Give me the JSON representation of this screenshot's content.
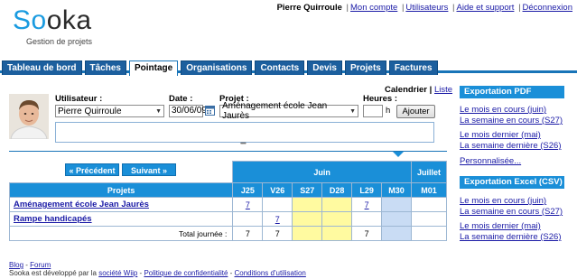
{
  "logo": {
    "blue": "So",
    "dark": "oka",
    "tagline": "Gestion de projets"
  },
  "topnav": {
    "user": "Pierre Quirroule",
    "account": "Mon compte",
    "users": "Utilisateurs",
    "help": "Aide et support",
    "logout": "Déconnexion"
  },
  "tabs": [
    "Tableau de bord",
    "Tâches",
    "Pointage",
    "Organisations",
    "Contacts",
    "Devis",
    "Projets",
    "Factures"
  ],
  "form": {
    "user_label": "Utilisateur :",
    "user_value": "Pierre Quirroule",
    "date_label": "Date :",
    "date_value": "30/06/09",
    "project_label": "Projet :",
    "project_value": "Aménagement école Jean Jaurès",
    "hours_label": "Heures :",
    "hours_unit": "h",
    "add_button": "Ajouter",
    "view_calendar": "Calendrier",
    "view_sep": "|",
    "view_list": "Liste"
  },
  "table": {
    "prev": "Précédent",
    "next": "Suivant",
    "month1": "Juin",
    "month2": "Juillet",
    "projects_header": "Projets",
    "days": [
      "J25",
      "V26",
      "S27",
      "D28",
      "L29",
      "M30",
      "M01"
    ],
    "rows": [
      {
        "name": "Aménagement école Jean Jaurès",
        "cells": [
          "7",
          "",
          "",
          "",
          "7",
          "",
          ""
        ]
      },
      {
        "name": "Rampe handicapés",
        "cells": [
          "",
          "7",
          "",
          "",
          "",
          "",
          ""
        ]
      }
    ],
    "total_label": "Total journée :",
    "totals": [
      "7",
      "7",
      "",
      "",
      "7",
      "",
      ""
    ]
  },
  "sidebar": {
    "pdf_title": "Exportation PDF",
    "pdf_links": [
      "Le mois en cours (juin)",
      "La semaine en cours (S27)",
      "Le mois dernier (mai)",
      "La semaine dernière (S26)",
      "Personnalisée..."
    ],
    "csv_title": "Exportation Excel (CSV)",
    "csv_links": [
      "Le mois en cours (juin)",
      "La semaine en cours (S27)",
      "Le mois dernier (mai)",
      "La semaine dernière (S26)"
    ]
  },
  "footer": {
    "blog": "Blog",
    "dash": "-",
    "forum": "Forum",
    "dev_text": "Sooka est développé par la",
    "wiip": "société Wiip",
    "privacy": "Politique de confidentialité",
    "terms": "Conditions d'utilisation"
  }
}
